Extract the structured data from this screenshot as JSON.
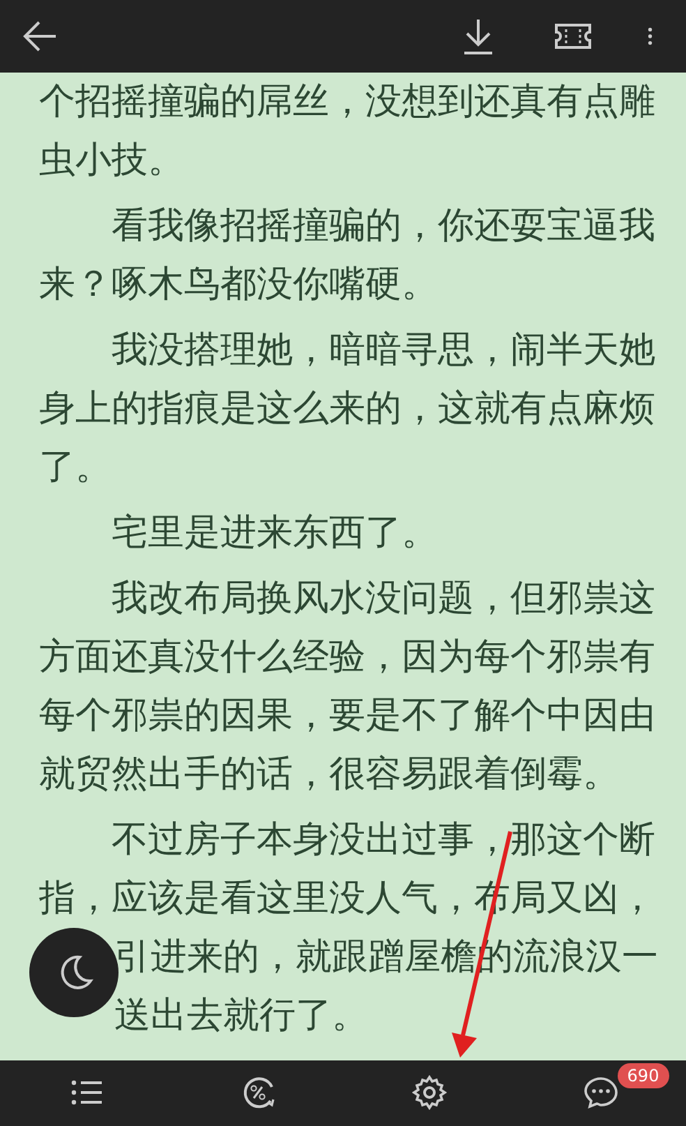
{
  "paragraphs": [
    {
      "indent": false,
      "text": "个招摇撞骗的屌丝，没想到还真有点雕虫小技。"
    },
    {
      "indent": true,
      "text": "看我像招摇撞骗的，你还耍宝逼我来？啄木鸟都没你嘴硬。"
    },
    {
      "indent": true,
      "text": "我没搭理她，暗暗寻思，闹半天她身上的指痕是这么来的，这就有点麻烦了。"
    },
    {
      "indent": true,
      "text": "宅里是进来东西了。"
    },
    {
      "indent": true,
      "text": "我改布局换风水没问题，但邪祟这方面还真没什么经验，因为每个邪祟有每个邪祟的因果，要是不了解个中因由就贸然出手的话，很容易跟着倒霉。"
    },
    {
      "indent": true,
      "lines": [
        {
          "text": "不过房子本身没出过事，那这个断",
          "covered": false
        },
        {
          "text": "指，应该是看这里没人气，布局又凶，",
          "covered": false
        },
        {
          "text": "引进来的，就跟蹭屋檐的流浪汉一",
          "covered": true
        },
        {
          "text": "送出去就行了。",
          "covered": true
        }
      ]
    }
  ],
  "bottom_bar": {
    "items": [
      {
        "kind": "list"
      },
      {
        "kind": "discount"
      },
      {
        "kind": "settings"
      },
      {
        "kind": "comments",
        "badge": "690"
      }
    ]
  }
}
